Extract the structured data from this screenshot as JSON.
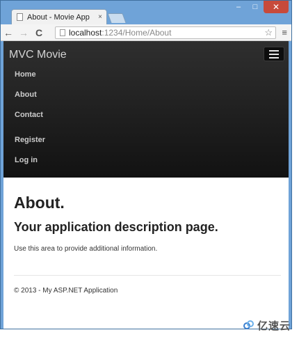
{
  "browser": {
    "tab_title": "About - Movie App",
    "tab_close": "×",
    "window_controls": {
      "minimize": "–",
      "maximize": "□",
      "close": "✕"
    },
    "url_host": "localhost",
    "url_path": ":1234/Home/About",
    "icons": {
      "back": "←",
      "forward": "→",
      "reload": "C",
      "star": "☆",
      "menu": "≡"
    }
  },
  "navbar": {
    "brand": "MVC Movie",
    "links": [
      "Home",
      "About",
      "Contact"
    ],
    "account_links": [
      "Register",
      "Log in"
    ]
  },
  "main": {
    "title": "About.",
    "subtitle": "Your application description page.",
    "body": "Use this area to provide additional information."
  },
  "footer": {
    "text": "© 2013 - My ASP.NET Application"
  },
  "watermark": {
    "text": "亿速云"
  },
  "colors": {
    "navbar": "#1b1b1b",
    "chrome": "#6fa3d8",
    "close_button": "#c74a3b"
  }
}
